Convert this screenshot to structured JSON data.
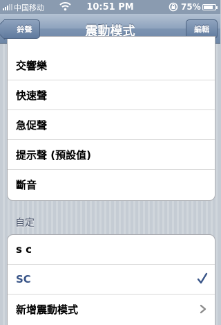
{
  "status_bar": {
    "carrier": "中国移动",
    "time": "10:51 PM",
    "battery": "75%"
  },
  "nav": {
    "title": "震動模式",
    "back_label": "鈴聲",
    "edit_label": "編輯"
  },
  "standard_list": [
    {
      "label": "交響樂"
    },
    {
      "label": "快速聲"
    },
    {
      "label": "急促聲"
    },
    {
      "label": "提示聲 (預設值)"
    },
    {
      "label": "斷音"
    }
  ],
  "custom_section": {
    "header": "自定",
    "items": [
      {
        "label": "s c"
      },
      {
        "label": "SC",
        "selected": true
      },
      {
        "label": "新增震動模式"
      }
    ]
  },
  "colors": {
    "navbar": "#7d94b2",
    "selected_text": "#385487",
    "checkmark": "#385487"
  }
}
